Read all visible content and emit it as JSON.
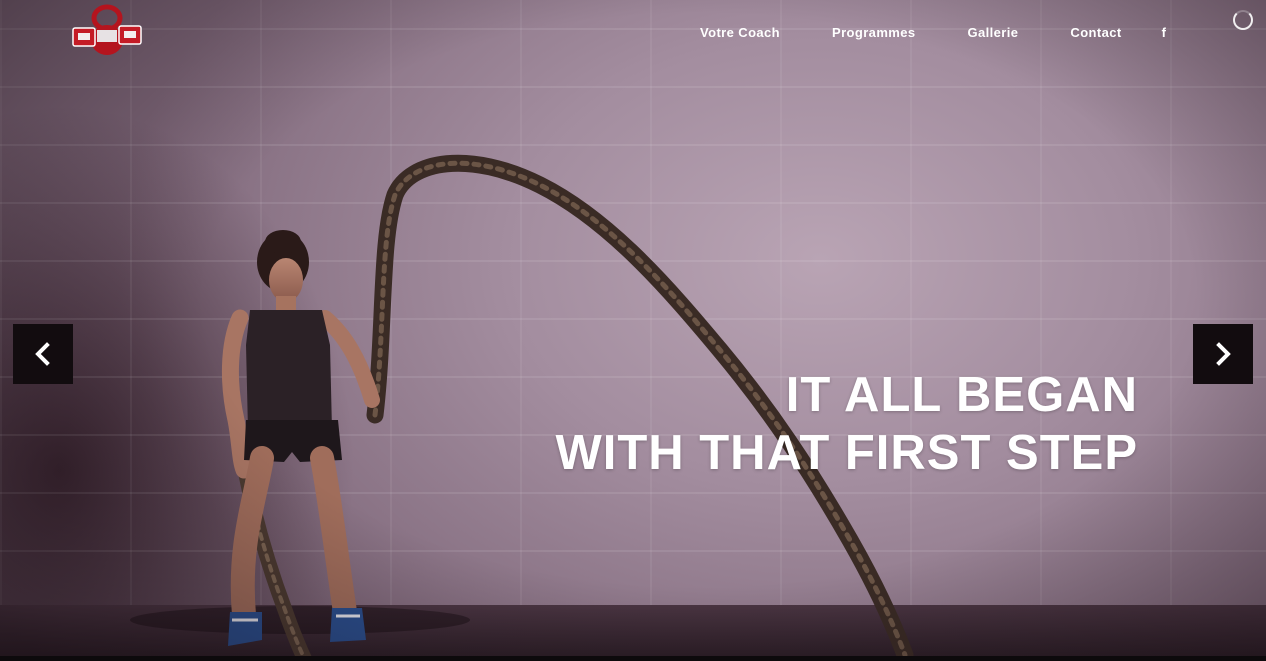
{
  "nav": {
    "items": [
      "Votre Coach",
      "Programmes",
      "Gallerie",
      "Contact"
    ],
    "social": "f"
  },
  "slider": {
    "prev_symbol": "❮",
    "next_symbol": "❯"
  },
  "hero": {
    "line1": "IT ALL BEGAN",
    "line2": "WITH THAT FIRST STEP"
  },
  "colors": {
    "logo_red": "#b4141e",
    "arrow_bg": "#120c0f",
    "text": "#ffffff"
  },
  "icons": {
    "logo": "kettlebell-logo-icon",
    "social": "facebook-icon",
    "loading": "loading-spinner-icon",
    "prev": "chevron-left-icon",
    "next": "chevron-right-icon"
  }
}
